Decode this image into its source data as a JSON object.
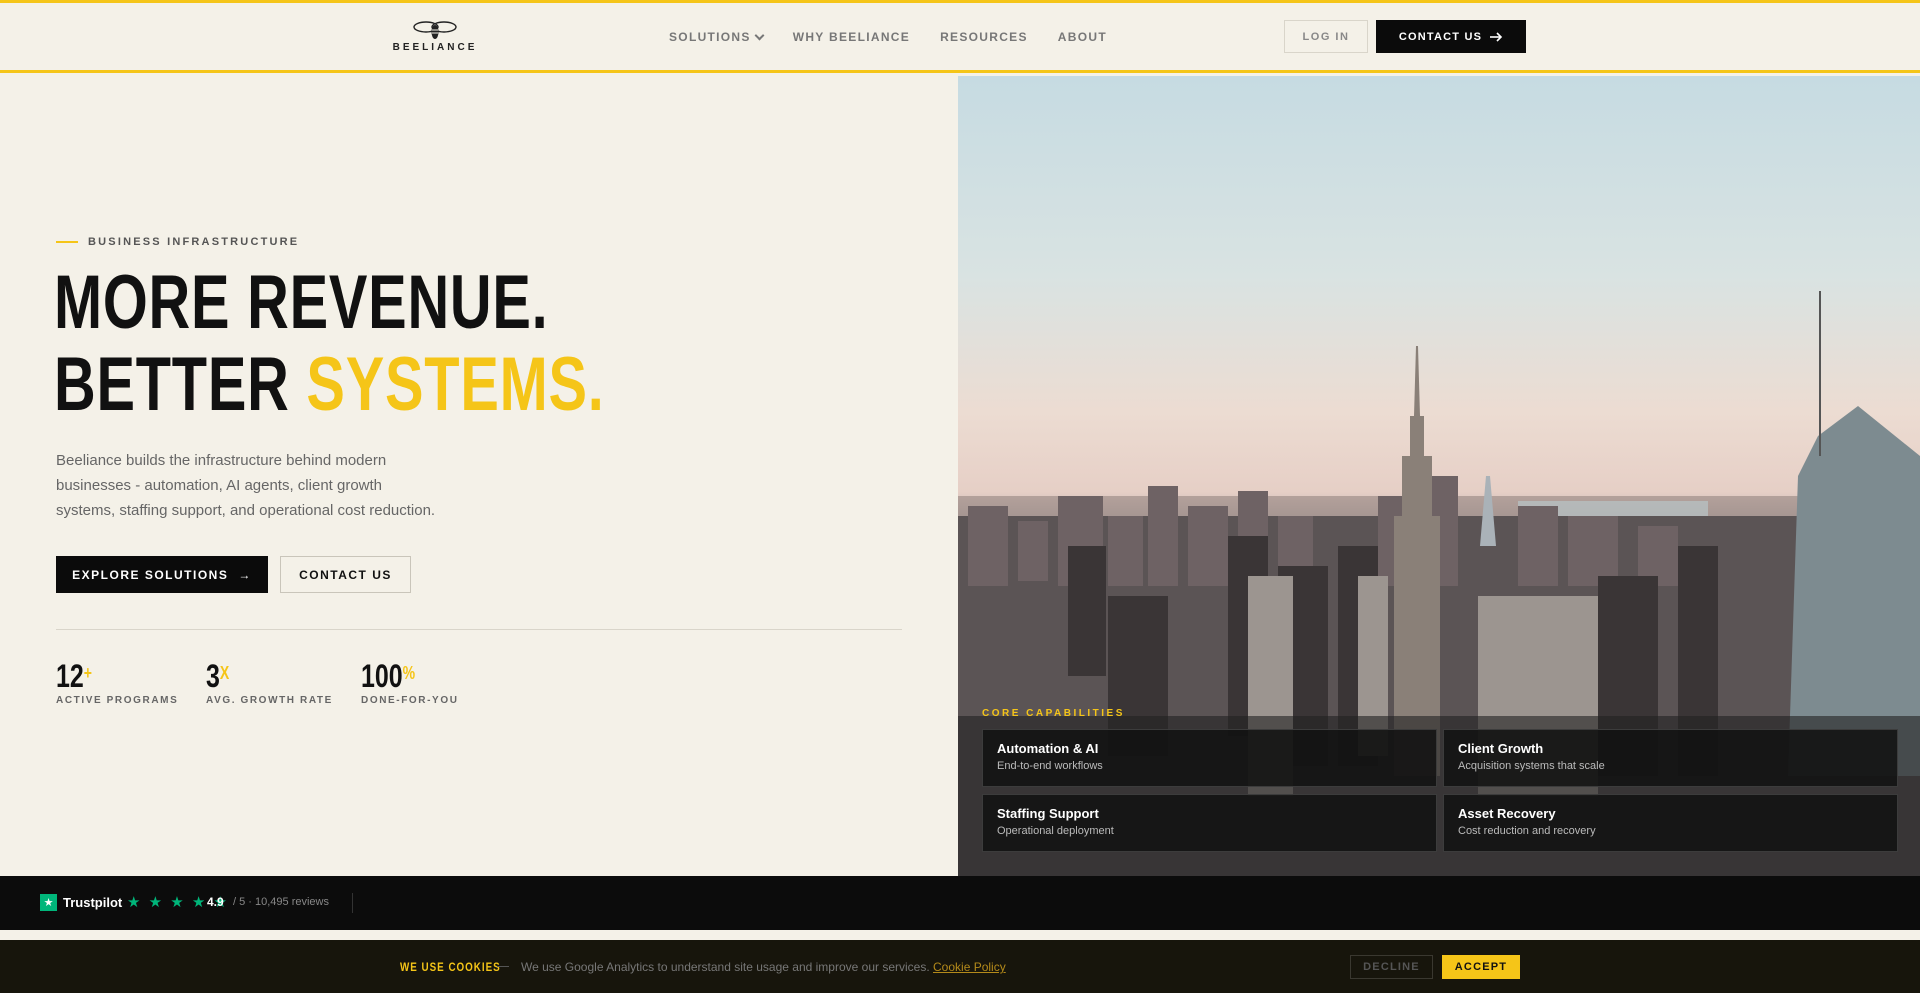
{
  "brand": {
    "name": "BEELIANCE",
    "accent_color": "#f5c518",
    "logo_icon": "bee-icon"
  },
  "nav": {
    "links": [
      {
        "label": "SOLUTIONS",
        "has_dropdown": true
      },
      {
        "label": "WHY BEELIANCE"
      },
      {
        "label": "RESOURCES"
      },
      {
        "label": "ABOUT"
      }
    ],
    "login_label": "LOG IN",
    "contact_label": "CONTACT US",
    "contact_icon": "arrow-right-icon"
  },
  "hero": {
    "eyebrow": "BUSINESS INFRASTRUCTURE",
    "headline_line1": "MORE REVENUE.",
    "headline_line2_prefix": "BETTER ",
    "headline_line2_accent": "SYSTEMS.",
    "lead": "Beeliance builds the infrastructure behind modern businesses - automation, AI agents, client growth systems, staffing support, and operational cost reduction.",
    "primary_cta": "EXPLORE SOLUTIONS",
    "primary_cta_arrow": "→",
    "secondary_cta": "CONTACT US",
    "stats": [
      {
        "value": "12",
        "suffix": "+",
        "label": "ACTIVE PROGRAMS"
      },
      {
        "value": "3",
        "suffix": "X",
        "label": "AVG. GROWTH RATE"
      },
      {
        "value": "100",
        "suffix": "%",
        "label": "DONE-FOR-YOU"
      }
    ]
  },
  "capabilities": {
    "label": "CORE CAPABILITIES",
    "items": [
      {
        "title": "Automation & AI",
        "subtitle": "End-to-end workflows"
      },
      {
        "title": "Client Growth",
        "subtitle": "Acquisition systems that scale"
      },
      {
        "title": "Staffing Support",
        "subtitle": "Operational deployment"
      },
      {
        "title": "Asset Recovery",
        "subtitle": "Cost reduction and recovery"
      }
    ]
  },
  "trust": {
    "provider": "Trustpilot",
    "stars": "★ ★ ★ ★ ★",
    "score": "4.9",
    "count_text": "/ 5 · 10,495 reviews",
    "star_color": "#00b67a"
  },
  "cookie": {
    "title": "WE USE COOKIES",
    "text": "We use Google Analytics to understand site usage and improve our services.",
    "link_label": "Cookie Policy",
    "decline_label": "DECLINE",
    "accept_label": "ACCEPT"
  }
}
